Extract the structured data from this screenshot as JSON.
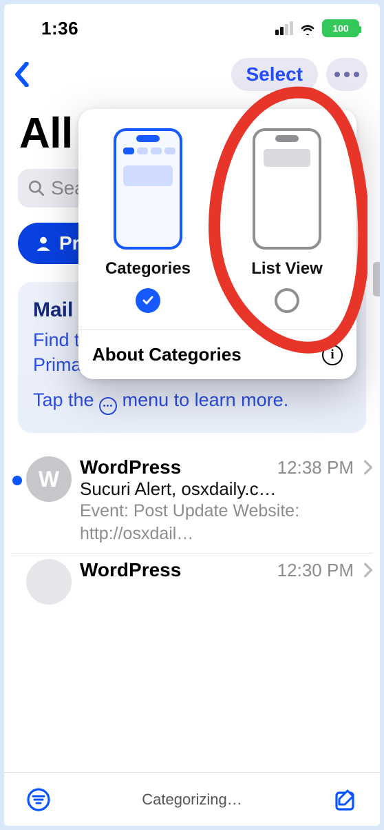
{
  "status": {
    "time": "1:36",
    "battery_text": "100"
  },
  "nav": {
    "select_label": "Select"
  },
  "page": {
    "title": "All Inboxes"
  },
  "search": {
    "placeholder": "Search"
  },
  "primary": {
    "label": "Primary"
  },
  "info_card": {
    "heading": "Mail Categorization",
    "line1": "Find the messages that matter most in Primary and organize everything else.",
    "line2_pre": "Tap the ",
    "line2_post": " menu to learn more."
  },
  "popup": {
    "opt1_label": "Categories",
    "opt2_label": "List View",
    "about_label": "About Categories"
  },
  "mails": [
    {
      "initial": "W",
      "sender": "WordPress",
      "time": "12:38 PM",
      "subject": "Sucuri Alert, osxdaily.c…",
      "preview": "Event: Post Update Website: http://osxdail…",
      "unread": true
    },
    {
      "initial": "",
      "sender": "WordPress",
      "time": "12:30 PM",
      "subject": "",
      "preview": "",
      "unread": false
    }
  ],
  "toolbar": {
    "status": "Categorizing…"
  }
}
